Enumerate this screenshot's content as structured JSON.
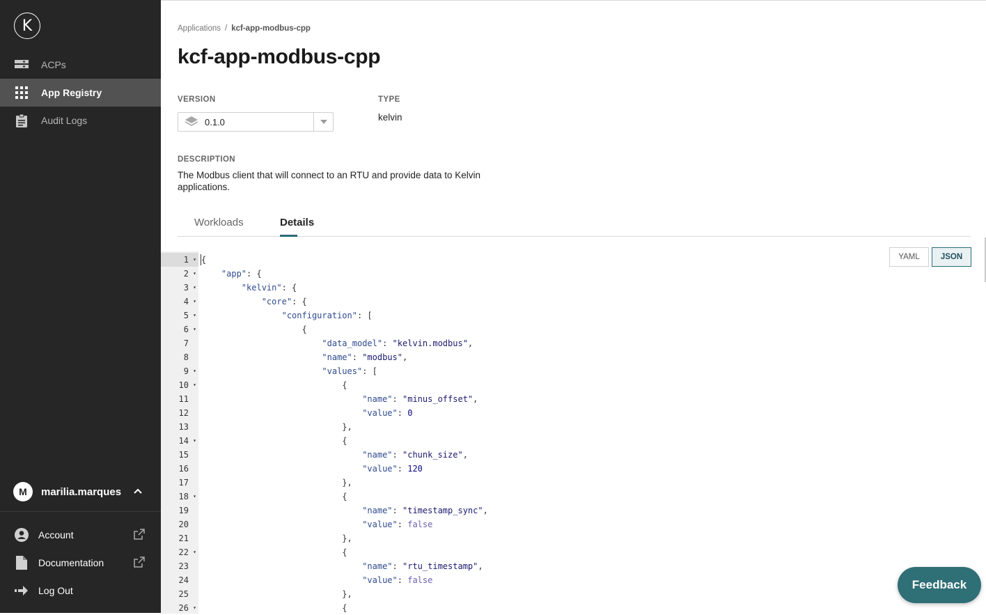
{
  "sidebar": {
    "logo_letter": "K",
    "nav": [
      {
        "label": "ACPs",
        "icon": "server-icon"
      },
      {
        "label": "App Registry",
        "icon": "grid-icon",
        "active": true
      },
      {
        "label": "Audit Logs",
        "icon": "clipboard-icon"
      }
    ],
    "user": {
      "initial": "M",
      "name": "marilia.marques"
    },
    "footer": [
      {
        "label": "Account",
        "icon": "account-icon",
        "external": true
      },
      {
        "label": "Documentation",
        "icon": "document-icon",
        "external": true
      },
      {
        "label": "Log Out",
        "icon": "logout-icon"
      }
    ]
  },
  "breadcrumb": {
    "parent": "Applications",
    "separator": "/",
    "current": "kcf-app-modbus-cpp"
  },
  "page_title": "kcf-app-modbus-cpp",
  "version": {
    "label": "VERSION",
    "value": "0.1.0"
  },
  "type": {
    "label": "TYPE",
    "value": "kelvin"
  },
  "description": {
    "label": "DESCRIPTION",
    "text": "The Modbus client that will connect to an RTU and provide data to Kelvin applications."
  },
  "tabs": [
    {
      "label": "Workloads"
    },
    {
      "label": "Details",
      "active": true
    }
  ],
  "format_buttons": {
    "yaml": "YAML",
    "json": "JSON",
    "selected": "JSON"
  },
  "feedback_label": "Feedback",
  "colors": {
    "sidebar_bg": "#262626",
    "accent": "#2a6c79",
    "feedback_bg": "#2f6f76"
  },
  "code": {
    "line_numbers": [
      "1",
      "2",
      "3",
      "4",
      "5",
      "6",
      "7",
      "8",
      "9",
      "10",
      "11",
      "12",
      "13",
      "14",
      "15",
      "16",
      "17",
      "18",
      "19",
      "20",
      "21",
      "22",
      "23",
      "24",
      "25",
      "26"
    ],
    "lines": [
      {
        "indent": "",
        "parts": [
          [
            "p",
            "{"
          ]
        ],
        "fold": true
      },
      {
        "indent": "    ",
        "parts": [
          [
            "k",
            "\"app\""
          ],
          [
            "p",
            ": {"
          ]
        ],
        "fold": true
      },
      {
        "indent": "        ",
        "parts": [
          [
            "k",
            "\"kelvin\""
          ],
          [
            "p",
            ": {"
          ]
        ],
        "fold": true
      },
      {
        "indent": "            ",
        "parts": [
          [
            "k",
            "\"core\""
          ],
          [
            "p",
            ": {"
          ]
        ],
        "fold": true
      },
      {
        "indent": "                ",
        "parts": [
          [
            "k",
            "\"configuration\""
          ],
          [
            "p",
            ": ["
          ]
        ],
        "fold": true
      },
      {
        "indent": "                    ",
        "parts": [
          [
            "p",
            "{"
          ]
        ],
        "fold": true
      },
      {
        "indent": "                        ",
        "parts": [
          [
            "k",
            "\"data_model\""
          ],
          [
            "p",
            ": "
          ],
          [
            "s",
            "\"kelvin.modbus\""
          ],
          [
            "p",
            ","
          ]
        ],
        "fold": false
      },
      {
        "indent": "                        ",
        "parts": [
          [
            "k",
            "\"name\""
          ],
          [
            "p",
            ": "
          ],
          [
            "s",
            "\"modbus\""
          ],
          [
            "p",
            ","
          ]
        ],
        "fold": false
      },
      {
        "indent": "                        ",
        "parts": [
          [
            "k",
            "\"values\""
          ],
          [
            "p",
            ": ["
          ]
        ],
        "fold": true
      },
      {
        "indent": "                            ",
        "parts": [
          [
            "p",
            "{"
          ]
        ],
        "fold": true
      },
      {
        "indent": "                                ",
        "parts": [
          [
            "k",
            "\"name\""
          ],
          [
            "p",
            ": "
          ],
          [
            "s",
            "\"minus_offset\""
          ],
          [
            "p",
            ","
          ]
        ],
        "fold": false
      },
      {
        "indent": "                                ",
        "parts": [
          [
            "k",
            "\"value\""
          ],
          [
            "p",
            ": "
          ],
          [
            "n",
            "0"
          ]
        ],
        "fold": false
      },
      {
        "indent": "                            ",
        "parts": [
          [
            "p",
            "},"
          ]
        ],
        "fold": false
      },
      {
        "indent": "                            ",
        "parts": [
          [
            "p",
            "{"
          ]
        ],
        "fold": true
      },
      {
        "indent": "                                ",
        "parts": [
          [
            "k",
            "\"name\""
          ],
          [
            "p",
            ": "
          ],
          [
            "s",
            "\"chunk_size\""
          ],
          [
            "p",
            ","
          ]
        ],
        "fold": false
      },
      {
        "indent": "                                ",
        "parts": [
          [
            "k",
            "\"value\""
          ],
          [
            "p",
            ": "
          ],
          [
            "n",
            "120"
          ]
        ],
        "fold": false
      },
      {
        "indent": "                            ",
        "parts": [
          [
            "p",
            "},"
          ]
        ],
        "fold": false
      },
      {
        "indent": "                            ",
        "parts": [
          [
            "p",
            "{"
          ]
        ],
        "fold": true
      },
      {
        "indent": "                                ",
        "parts": [
          [
            "k",
            "\"name\""
          ],
          [
            "p",
            ": "
          ],
          [
            "s",
            "\"timestamp_sync\""
          ],
          [
            "p",
            ","
          ]
        ],
        "fold": false
      },
      {
        "indent": "                                ",
        "parts": [
          [
            "k",
            "\"value\""
          ],
          [
            "p",
            ": "
          ],
          [
            "b",
            "false"
          ]
        ],
        "fold": false
      },
      {
        "indent": "                            ",
        "parts": [
          [
            "p",
            "},"
          ]
        ],
        "fold": false
      },
      {
        "indent": "                            ",
        "parts": [
          [
            "p",
            "{"
          ]
        ],
        "fold": true
      },
      {
        "indent": "                                ",
        "parts": [
          [
            "k",
            "\"name\""
          ],
          [
            "p",
            ": "
          ],
          [
            "s",
            "\"rtu_timestamp\""
          ],
          [
            "p",
            ","
          ]
        ],
        "fold": false
      },
      {
        "indent": "                                ",
        "parts": [
          [
            "k",
            "\"value\""
          ],
          [
            "p",
            ": "
          ],
          [
            "b",
            "false"
          ]
        ],
        "fold": false
      },
      {
        "indent": "                            ",
        "parts": [
          [
            "p",
            "},"
          ]
        ],
        "fold": false
      },
      {
        "indent": "                            ",
        "parts": [
          [
            "p",
            "{"
          ]
        ],
        "fold": true
      }
    ]
  }
}
